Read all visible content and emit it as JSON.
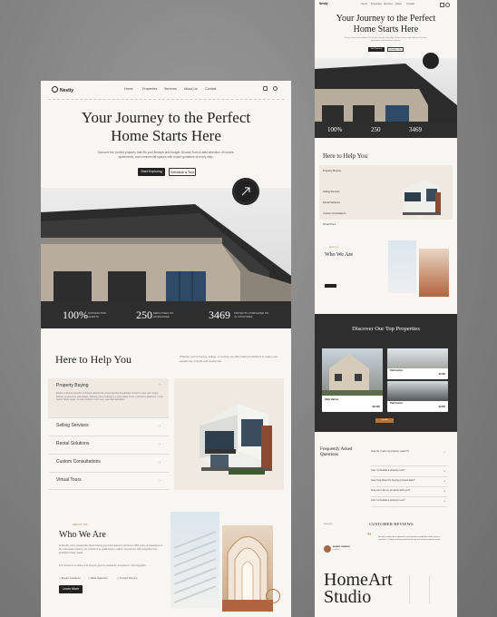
{
  "main": {
    "logo": "Nestiy",
    "nav": [
      "Home",
      "Properties",
      "Services",
      "About Us",
      "Contact"
    ],
    "hero": {
      "title_line1": "Your Journey to the Perfect",
      "title_line2": "Home Starts Here",
      "subtitle": "Discover the perfect property that fits your lifestyle and budget. Browse from a wide selection of homes, apartments, and commercial spaces with expert guidance at every step.",
      "primary_button": "Start Exploring",
      "secondary_button": "Schedule a Tour",
      "badge_text": "GET IN TOUCH · GET IN TOUCH ·"
    },
    "stats": [
      {
        "num": "100%",
        "label": "SATISFACTION CLIENTS"
      },
      {
        "num": "250",
        "label": "EMPLOYEES ON WORLDWIDE"
      },
      {
        "num": "3469",
        "label": "PROJECTS COMPLETED ON 24 COUNTRIES"
      }
    ],
    "help": {
      "title": "Here to Help You",
      "desc": "Whether you're buying, selling, or renting, we offer tailored solutions to make your experience smooth and stress-free.",
      "services": [
        {
          "label": "Property Buying",
          "desc": "Explore a diverse selection of homes, apartments, and properties thoughtfully curated to meet your unique lifestyle, preferences, and budget. Whether you're looking for a cozy starter home, a luxurious apartment, or the perfect family space, we have options to suit every need and aspiration."
        },
        {
          "label": "Selling Services"
        },
        {
          "label": "Rental Solutions"
        },
        {
          "label": "Custom Consultations"
        },
        {
          "label": "Virtual Tours"
        }
      ]
    },
    "about": {
      "eyebrow": "ABOUT US",
      "title": "Who We Are",
      "desc1": "At Nestify, we're passionate about helping you find a place to call home. With years of experience in the real estate industry, our mission is to guide buyers, sellers, and renters with properties that perfectly fit their needs.",
      "desc2": "Our mission is to make your property journey seamless, transparent, and enjoyable.",
      "features": [
        "Expert Guidance",
        "Wide Selection",
        "Trusted Service"
      ],
      "button": "Learn More"
    }
  },
  "right": {
    "logo": "Nestiy",
    "nav": [
      "Home",
      "Properties",
      "Services",
      "About",
      "Contact"
    ],
    "hero_title_line1": "Your Journey to the Perfect",
    "hero_title_line2": "Home Starts Here",
    "hero_sub": "Discover the perfect property that fits your lifestyle and budget. Browse from a wide selection of homes, apartments, and commercial spaces.",
    "btn1": "Start Exploring",
    "btn2": "Schedule a Tour",
    "stats": [
      "100%",
      "250",
      "3469"
    ],
    "help_title": "Here to Help You",
    "services": [
      "Property Buying",
      "Selling Services",
      "Rental Solutions",
      "Custom Consultations",
      "Virtual Tours"
    ],
    "about_title": "Who We Are",
    "properties_title": "Discover Our Top Properties",
    "property_cards": [
      {
        "name": "Palm Harbor",
        "price": "$2,095"
      },
      {
        "name": "Palm Harbor",
        "price": "$2,095"
      },
      {
        "name": "Palm Harbor",
        "price": "$2,095"
      },
      {
        "name": "Palm Harbor",
        "price": "$2,095"
      }
    ],
    "view_all": "View All",
    "faq_title_line1": "Frequently Asked",
    "faq_title_line2": "Questions",
    "faqs": [
      "How do I start my property search?",
      "Can I schedule a property tour?",
      "How long does the buying process take?",
      "How can I list my property with you?",
      "Can I schedule a property tour?"
    ],
    "reviews_eyebrow": "REVIEWS",
    "reviews_title": "CUSTOMER REVIEWS",
    "reviewer": "ALBERT JOHNSON",
    "reviewer_role": "Customer",
    "review_text": "Nestify's professional approach and expertise made the whole process seamless. I highly recommend them for any real estate property needs.",
    "footer_brand_line1": "HomeArt",
    "footer_brand_line2": "Studio"
  },
  "colors": {
    "accent": "#b0763a",
    "dark": "#2e2e2e",
    "page": "#f7f6f3",
    "backdrop": "#858585"
  }
}
